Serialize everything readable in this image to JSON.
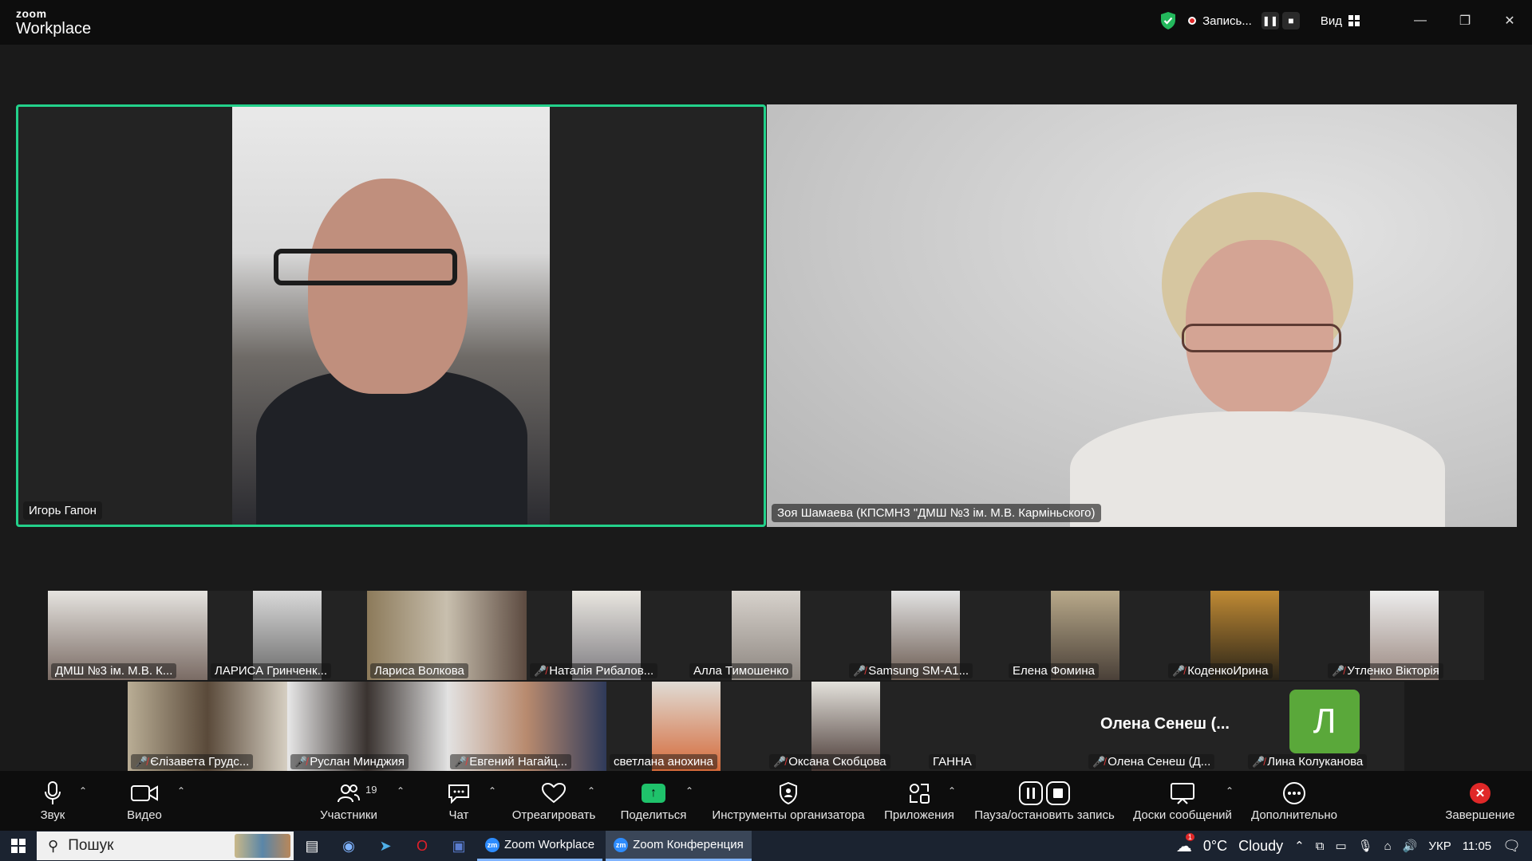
{
  "window": {
    "brand_small": "zoom",
    "brand_large": "Workplace",
    "recording_label": "Запись...",
    "view_label": "Вид"
  },
  "speakers": [
    {
      "name": "Игорь Гапон"
    },
    {
      "name": "Зоя Шамаева (КПСМНЗ \"ДМШ №3 ім. М.В. Карміньского)"
    }
  ],
  "thumbnails_row1": [
    {
      "name": "ДМШ №3 ім. М.В. К...",
      "muted": false
    },
    {
      "name": "ЛАРИСА Гринченк...",
      "muted": false
    },
    {
      "name": "Лариса Волкова",
      "muted": false
    },
    {
      "name": "Наталія Рибалов...",
      "muted": true
    },
    {
      "name": "Алла Тимошенко",
      "muted": false
    },
    {
      "name": "Samsung SM-A1...",
      "muted": true
    },
    {
      "name": "Елена Фомина",
      "muted": false
    },
    {
      "name": "КоденкоИрина",
      "muted": true
    },
    {
      "name": "Утленко Вікторія",
      "muted": true
    }
  ],
  "thumbnails_row2": [
    {
      "name": "Єлізавета Грудс...",
      "muted": true
    },
    {
      "name": "Руслан Минджия",
      "muted": true
    },
    {
      "name": "Евгений Нагайц...",
      "muted": true
    },
    {
      "name": "светлана анохина",
      "muted": false
    },
    {
      "name": "Оксана Скобцова",
      "muted": true
    },
    {
      "name": "ГАННА",
      "muted": false
    },
    {
      "name": "Олена Сенеш (Д...",
      "muted": true,
      "display_name": "Олена Сенеш (..."
    },
    {
      "name": "Лина Колуканова",
      "muted": true,
      "avatar_letter": "Л"
    }
  ],
  "toolbar": {
    "audio": "Звук",
    "video": "Видео",
    "participants": "Участники",
    "participants_count": "19",
    "chat": "Чат",
    "react": "Отреагировать",
    "share": "Поделиться",
    "host_tools": "Инструменты организатора",
    "apps": "Приложения",
    "pause_record": "Пауза/остановить запись",
    "whiteboards": "Доски сообщений",
    "more": "Дополнительно",
    "end": "Завершение"
  },
  "taskbar": {
    "search_placeholder": "Пошук",
    "apps": [
      "Zoom Workplace",
      "Zoom Конференция"
    ],
    "weather_temp": "0°C",
    "weather_desc": "Cloudy",
    "weather_badge": "1",
    "language": "УКР",
    "time": "11:05"
  },
  "colors": {
    "active_speaker_border": "#23d18b",
    "share_green": "#1fc26b",
    "end_red": "#e02828",
    "mute_red": "#e83b3b"
  }
}
